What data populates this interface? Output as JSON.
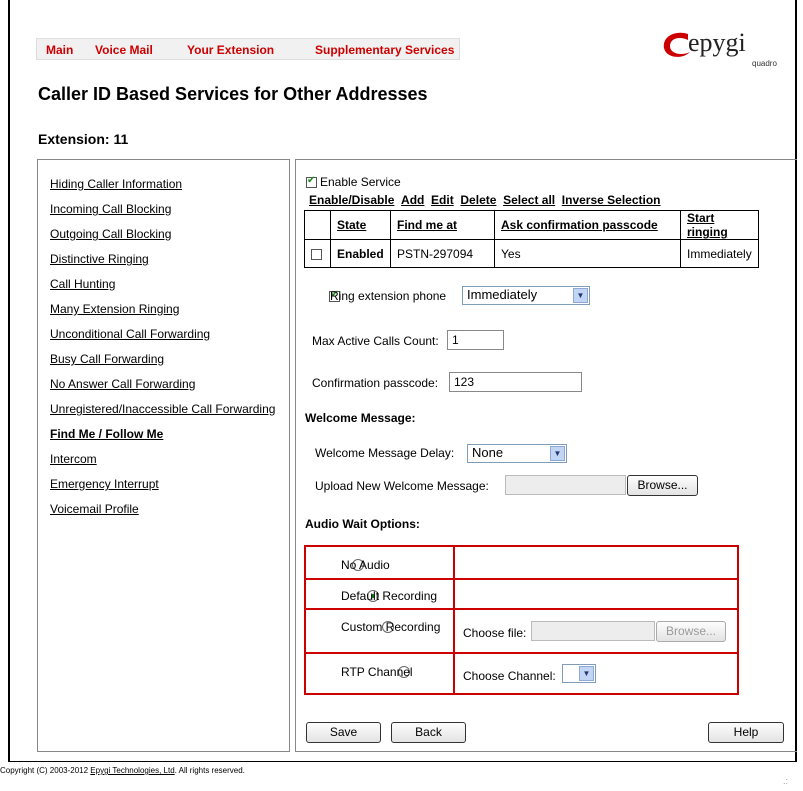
{
  "nav": {
    "main": "Main",
    "voice_mail": "Voice Mail",
    "your_extension": "Your Extension",
    "supplementary": "Supplementary Services"
  },
  "logo": {
    "brand": "epygi",
    "sub": "quadro",
    "accent": "#cc0000"
  },
  "page": {
    "title": "Caller ID Based Services for Other Addresses",
    "extension": "Extension: 11"
  },
  "sidebar": {
    "items": [
      "Hiding Caller Information",
      "Incoming Call Blocking",
      "Outgoing Call Blocking",
      "Distinctive Ringing",
      "Call Hunting",
      "Many Extension Ringing",
      "Unconditional Call Forwarding",
      "Busy Call Forwarding",
      "No Answer Call Forwarding",
      "Unregistered/Inaccessible Call Forwarding",
      "Find Me / Follow Me",
      "Intercom",
      "Emergency Interrupt",
      "Voicemail Profile"
    ],
    "active": "Find Me / Follow Me"
  },
  "service": {
    "enable_label": "Enable Service",
    "enable_checked": true
  },
  "toolbar": {
    "enable_disable": "Enable/Disable",
    "add": "Add",
    "edit": "Edit",
    "delete": "Delete",
    "select_all": "Select all",
    "inverse": "Inverse Selection"
  },
  "table": {
    "headers": [
      "State",
      "Find me at",
      "Ask confirmation passcode",
      "Start ringing"
    ],
    "rows": [
      {
        "checked": false,
        "state": "Enabled",
        "find_me_at": "PSTN-297094",
        "ask_confirmation": "Yes",
        "start_ringing": "Immediately"
      }
    ]
  },
  "ring_ext": {
    "label": "Ring extension phone",
    "checked": true,
    "value": "Immediately"
  },
  "max_active": {
    "label": "Max Active Calls Count:",
    "value": "1"
  },
  "passcode": {
    "label": "Confirmation passcode:",
    "value": "123"
  },
  "welcome": {
    "heading": "Welcome Message:",
    "delay_label": "Welcome Message Delay:",
    "delay_value": "None",
    "upload_label": "Upload New Welcome Message:",
    "browse": "Browse..."
  },
  "audio": {
    "heading": "Audio Wait Options:",
    "no_audio": "No Audio",
    "default_recording": "Default Recording",
    "custom_recording": "Custom Recording",
    "choose_file": "Choose file:",
    "browse": "Browse...",
    "rtp_channel": "RTP Channel",
    "choose_channel": "Choose Channel:",
    "selected": "Default Recording"
  },
  "buttons": {
    "save": "Save",
    "back": "Back",
    "help": "Help"
  },
  "footer": {
    "prefix": "Copyright (C) 2003-2012",
    "link": "Epygi Technologies, Ltd",
    "suffix": ". All rights reserved."
  }
}
